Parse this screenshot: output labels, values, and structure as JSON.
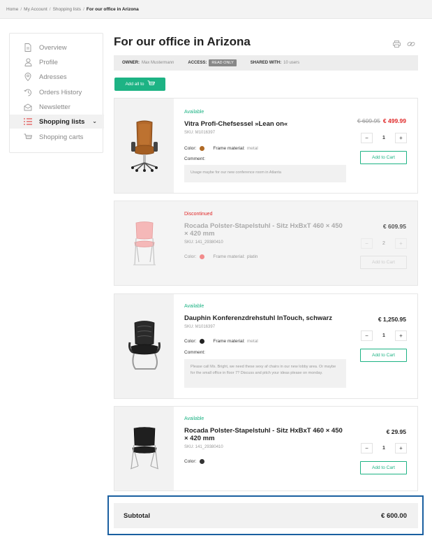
{
  "breadcrumb": [
    "Home",
    "My Account",
    "Shopping lists",
    "For our office in Arizona"
  ],
  "sidebar": {
    "items": [
      {
        "label": "Overview",
        "icon": "document-icon"
      },
      {
        "label": "Profile",
        "icon": "user-icon"
      },
      {
        "label": "Adresses",
        "icon": "location-pin-icon"
      },
      {
        "label": "Orders History",
        "icon": "history-icon"
      },
      {
        "label": "Newsletter",
        "icon": "envelope-icon"
      },
      {
        "label": "Shopping lists",
        "icon": "list-icon",
        "active": true,
        "chevron": "⌄"
      },
      {
        "label": "Shopping carts",
        "icon": "cart-icon"
      }
    ]
  },
  "page": {
    "title": "For our office in Arizona",
    "icons": [
      "print-icon",
      "link-icon"
    ]
  },
  "info": {
    "owner_label": "OWNER:",
    "owner": "Max Mustermann",
    "access_label": "ACCESS:",
    "access": "READ ONLY",
    "shared_label": "SHARED WITH:",
    "shared": "10 users"
  },
  "add_all_label": "Add all to",
  "products": [
    {
      "status": "Available",
      "status_type": "ok",
      "name": "Vitra Profi-Chefsessel »Lean on«",
      "sku": "SKU: M1016397",
      "color_label": "Color:",
      "color": "#b06a25",
      "frame_label": "Frame material:",
      "frame": "metal",
      "comment_label": "Comment:",
      "comment": "Usage maybe for our new conference room in Atlanta",
      "old_price": "€ 609.95",
      "price": "€ 499.99",
      "qty": "1",
      "minus": "−",
      "plus": "+",
      "cart_label": "Add to Cart"
    },
    {
      "status": "Discontinued",
      "status_type": "bad",
      "name": "Rocada Polster-Stapelstuhl - Sitz HxBxT 460 × 450 × 420 mm",
      "sku": "SKU: 141_29380410",
      "color_label": "Color:",
      "color": "#f2a0a0",
      "frame_label": "Frame material:",
      "frame": "platin",
      "price": "€ 609.95",
      "qty": "2",
      "minus": "−",
      "plus": "+",
      "cart_label": "Add to Cart"
    },
    {
      "status": "Available",
      "status_type": "ok",
      "name": "Dauphin Konferenzdrehstuhl InTouch, schwarz",
      "sku": "SKU: M1016397",
      "color_label": "Color:",
      "color": "#222222",
      "frame_label": "Frame material:",
      "frame": "metal",
      "comment_label": "Comment:",
      "comment": "Please call Ms. Bright, we need these sexy af chairs in our new lobby area. Or maybe for the small office in floor 7? Discuss and pitch your ideas please on monday.",
      "price": "€ 1,250.95",
      "qty": "1",
      "minus": "−",
      "plus": "+",
      "cart_label": "Add to Cart"
    },
    {
      "status": "Available",
      "status_type": "ok",
      "name": "Rocada Polster-Stapelstuhl - Sitz HxBxT 460 × 450 × 420 mm",
      "sku": "SKU: 141_29380410",
      "color_label": "Color:",
      "color": "#333333",
      "price": "€ 29.95",
      "qty": "1",
      "minus": "−",
      "plus": "+",
      "cart_label": "Add to Cart"
    }
  ],
  "subtotal": {
    "label": "Subtotal",
    "value": "€ 600.00"
  }
}
